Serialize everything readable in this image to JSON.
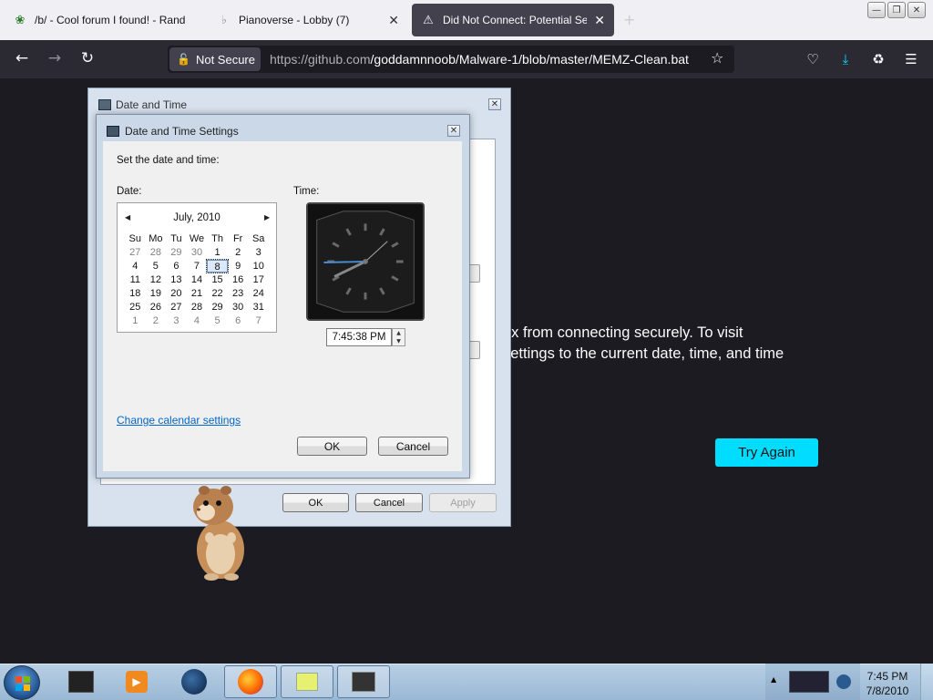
{
  "browser": {
    "tabs": [
      {
        "title": "/b/ - Cool forum I found! - Rand",
        "icon": "bug-icon"
      },
      {
        "title": "Pianoverse - Lobby (7)",
        "icon": "piano-icon"
      },
      {
        "title": "Did Not Connect: Potential Secu",
        "icon": "warning-icon"
      }
    ],
    "security_label": "Not Secure",
    "url_domain": "https://github.com",
    "url_path": "/goddamnnoob/Malware-1/blob/master/MEMZ-Clean.bat"
  },
  "error_page": {
    "line1": "ox from connecting securely. To visit",
    "line2": "settings to the current date, time, and time",
    "try_again": "Try Again"
  },
  "outer_dialog": {
    "title": "Date and Time",
    "ok": "OK",
    "cancel": "Cancel",
    "apply": "Apply"
  },
  "inner_dialog": {
    "title": "Date and Time Settings",
    "instruction": "Set the date and time:",
    "date_label": "Date:",
    "time_label": "Time:",
    "month_year": "July, 2010",
    "weekdays": [
      "Su",
      "Mo",
      "Tu",
      "We",
      "Th",
      "Fr",
      "Sa"
    ],
    "weeks": [
      [
        "27",
        "28",
        "29",
        "30",
        "1",
        "2",
        "3"
      ],
      [
        "4",
        "5",
        "6",
        "7",
        "8",
        "9",
        "10"
      ],
      [
        "11",
        "12",
        "13",
        "14",
        "15",
        "16",
        "17"
      ],
      [
        "18",
        "19",
        "20",
        "21",
        "22",
        "23",
        "24"
      ],
      [
        "25",
        "26",
        "27",
        "28",
        "29",
        "30",
        "31"
      ],
      [
        "1",
        "2",
        "3",
        "4",
        "5",
        "6",
        "7"
      ]
    ],
    "selected_day": "8",
    "time_value": "7:45:38 PM",
    "calendar_link": "Change calendar settings",
    "ok": "OK",
    "cancel": "Cancel"
  },
  "taskbar": {
    "time": "7:45 PM",
    "date": "7/8/2010",
    "accent": "#00ddff"
  }
}
